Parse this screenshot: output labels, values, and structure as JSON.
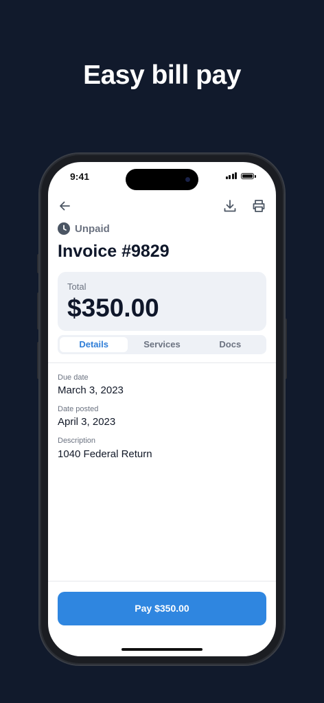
{
  "promo": {
    "headline": "Easy bill pay"
  },
  "status_bar": {
    "time": "9:41"
  },
  "header": {
    "back_icon": "arrow-left-icon",
    "download_icon": "download-icon",
    "print_icon": "printer-icon"
  },
  "invoice": {
    "status_icon": "clock-icon",
    "status": "Unpaid",
    "title": "Invoice #9829",
    "total_label": "Total",
    "total_amount": "$350.00"
  },
  "tabs": [
    {
      "label": "Details",
      "active": true
    },
    {
      "label": "Services",
      "active": false
    },
    {
      "label": "Docs",
      "active": false
    }
  ],
  "details": {
    "due_date_label": "Due date",
    "due_date": "March 3, 2023",
    "date_posted_label": "Date posted",
    "date_posted": "April 3, 2023",
    "description_label": "Description",
    "description": "1040 Federal Return"
  },
  "footer": {
    "pay_label": "Pay $350.00"
  },
  "colors": {
    "background": "#111a2c",
    "accent": "#2f86e0",
    "active_tab_text": "#2f7ed8",
    "card": "#eef1f6"
  }
}
